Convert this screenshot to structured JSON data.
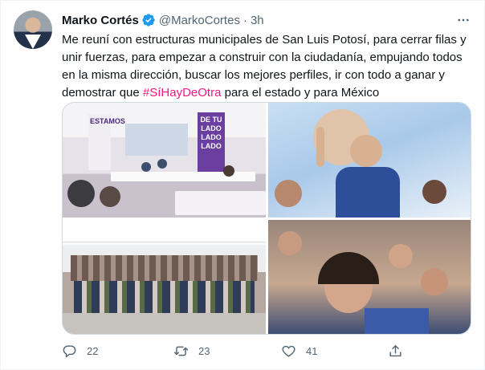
{
  "tweet": {
    "author_name": "Marko Cortés",
    "author_handle": "@MarkoCortes",
    "separator": "·",
    "timestamp": "3h",
    "text_before": "Me reuní con estructuras municipales de San Luis Potosí, para cerrar filas y unir fuerzas, para empezar a construir con la ciudadanía, empujando todos en la misma dirección, buscar los mejores perfiles, ir con todo a ganar y demostrar que ",
    "hashtag": "#SíHayDeOtra",
    "text_after": " para el estado y para México"
  },
  "media": {
    "banner_left": "ESTAMOS",
    "banner_right": "DE TU LADO LADO LADO"
  },
  "stats": {
    "replies": "22",
    "retweets": "23",
    "likes": "41"
  },
  "icons": {
    "verified": "verified-badge-icon",
    "more": "more-options-icon",
    "reply": "reply-icon",
    "retweet": "retweet-icon",
    "like": "heart-icon",
    "share": "share-icon"
  },
  "colors": {
    "hashtag": "#f91880",
    "verified": "#1d9bf0",
    "secondary_text": "#536471",
    "banner_purple": "#6a3fa0"
  }
}
